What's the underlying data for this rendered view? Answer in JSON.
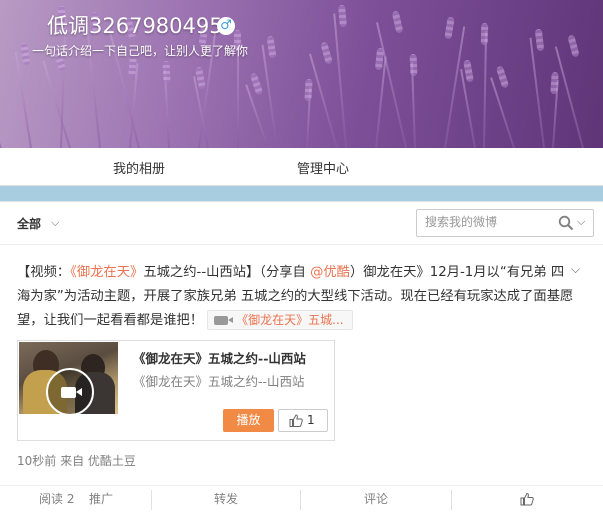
{
  "profile": {
    "nickname": "低调3267980495",
    "gender_icon": "male-icon",
    "gender_symbol": "♂",
    "intro": "一句话介绍一下自己吧，让别人更了解你"
  },
  "tabs": [
    {
      "label": "我的相册"
    },
    {
      "label": "管理中心"
    }
  ],
  "filter": {
    "all_label": "全部",
    "caret": "⌵",
    "search_placeholder": "搜索我的微博"
  },
  "post": {
    "prefix": "【视频：",
    "title_link": "《御龙在天》",
    "title_rest": "五城之约--山西站】（分享自 ",
    "source_link": "@优酷",
    "body": "）御龙在天》12月-1月以“有兄弟 四海为家”为活动主题，开展了家族兄弟 五城之约的大型线下活动。现在已经有玩家达成了面基愿望，让我们一起看看都是谁把！",
    "video_link_label": "《御龙在天》五城..."
  },
  "media": {
    "title": "《御龙在天》五城之约--山西站",
    "subtitle": "《御龙在天》五城之约--山西站",
    "play_label": "播放",
    "like_count": "1"
  },
  "meta": "10秒前 来自 优酷土豆",
  "actions": {
    "read": "阅读 2",
    "promote": "推广",
    "repost": "转发",
    "comment": "评论"
  },
  "colors": {
    "link": "#eb7350",
    "play_button": "#f08a45",
    "page_bg": "#a9cde0"
  }
}
